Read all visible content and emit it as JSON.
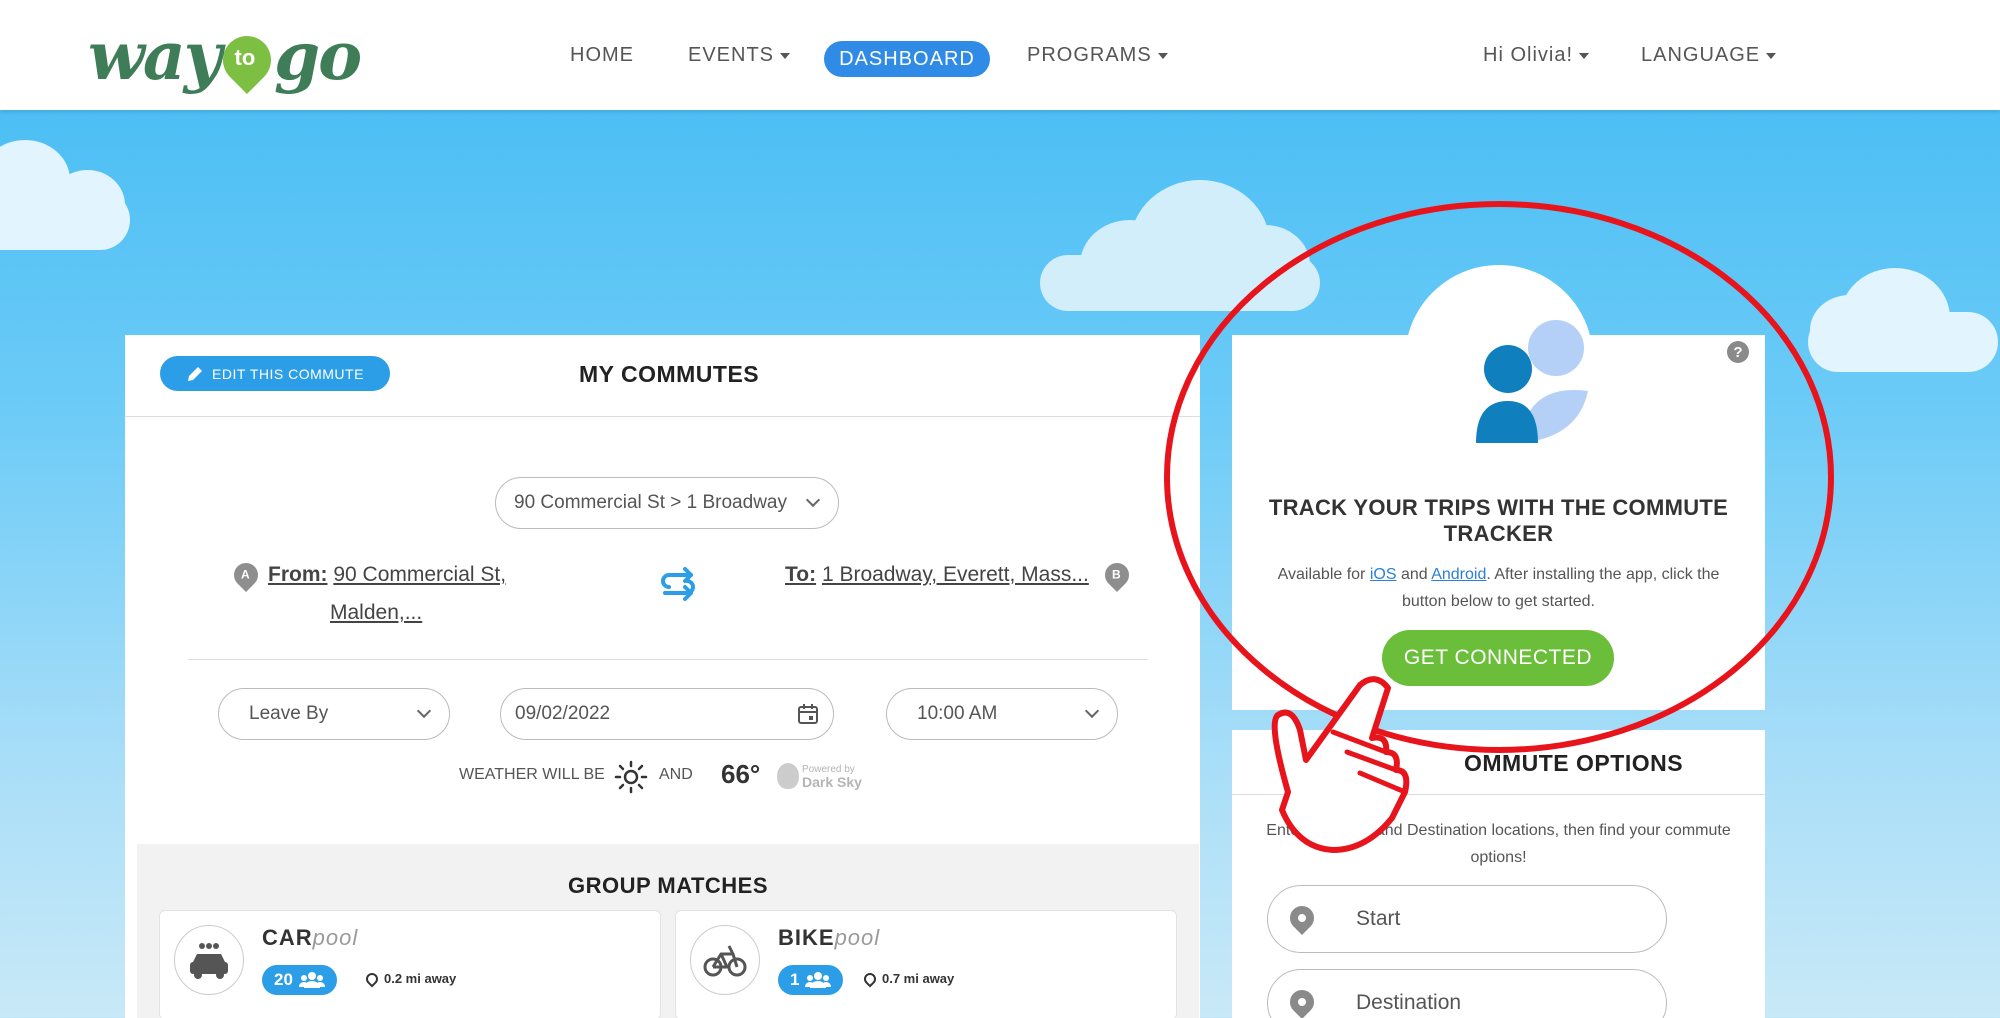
{
  "nav": {
    "logo": {
      "left": "way",
      "middle": "to",
      "right": "go"
    },
    "home": "HOME",
    "events": "EVENTS",
    "dashboard": "DASHBOARD",
    "programs": "PROGRAMS",
    "user": "Hi Olivia!",
    "language": "LANGUAGE"
  },
  "commutes": {
    "edit_label": "EDIT THIS COMMUTE",
    "title": "MY COMMUTES",
    "route_select": "90 Commercial St > 1 Broadway",
    "from_label": "From:",
    "from_line1": "90 Commercial St,",
    "from_line2": "Malden,...",
    "to_label": "To:",
    "to_value": "1 Broadway, Everett, Mass...",
    "marker_a": "A",
    "marker_b": "B",
    "leave_option": "Leave By",
    "date": "09/02/2022",
    "time": "10:00 AM",
    "weather_prefix": "WEATHER WILL BE",
    "weather_and": "AND",
    "temperature": "66°",
    "powered_line1": "Powered by",
    "powered_line2": "Dark Sky"
  },
  "group_matches": {
    "title": "GROUP MATCHES",
    "carpool": {
      "bold": "CAR",
      "italic": "pool",
      "count": "20",
      "distance": "0.2 mi away"
    },
    "bikepool": {
      "bold": "BIKE",
      "italic": "pool",
      "count": "1",
      "distance": "0.7 mi away"
    }
  },
  "tracker": {
    "title": "TRACK YOUR TRIPS WITH THE COMMUTE TRACKER",
    "desc_prefix": "Available for ",
    "ios": "iOS",
    "desc_and": " and ",
    "android": "Android",
    "desc_suffix": ". After installing the app, click the button below to get started.",
    "button": "GET CONNECTED",
    "help": "?"
  },
  "options": {
    "title": "COMMUTE OPTIONS",
    "title_visible": "OMMUTE OPTIONS",
    "desc_start": "Enter y",
    "desc_mid": "t and Destination locations, then find your commute options!",
    "start_placeholder": "Start",
    "destination_placeholder": "Destination"
  },
  "colors": {
    "accent_blue": "#2c9ee8",
    "nav_active": "#2f8be6",
    "green": "#6abe39",
    "annotation_red": "#e8141c"
  }
}
